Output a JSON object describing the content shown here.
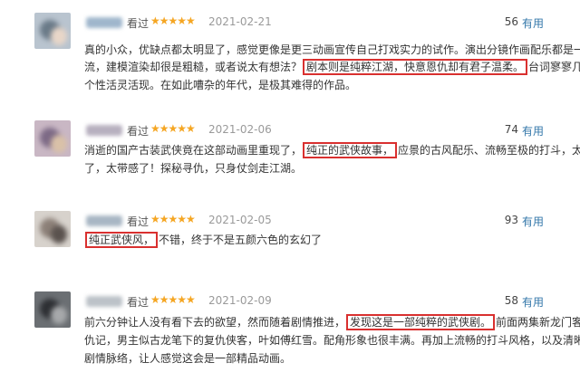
{
  "labels": {
    "watched": "看过",
    "stars": "★★★★★",
    "useful": "有用"
  },
  "colors": {
    "star": "#f5a623",
    "highlight_box": "#d9302f",
    "link": "#3377aa",
    "date": "#9a9a9a"
  },
  "reviews": [
    {
      "date": "2021-02-21",
      "useful_count": "56",
      "lines": [
        {
          "pre": "真的小众，优缺点都太明显了，感觉更像是更三动画宣传自己打戏实力的试作。演出分镜作画配乐都是一"
        },
        {
          "pre": "流，建模渲染却很是粗糙，或者说太有想法？",
          "hl": "剧本则是纯粹江湖，快意恩仇却有君子温柔。",
          "post": "台词寥寥几句，"
        },
        {
          "pre": "个性活灵活现。在如此嘈杂的年代，是极其难得的作品。"
        }
      ]
    },
    {
      "date": "2021-02-06",
      "useful_count": "74",
      "lines": [
        {
          "pre": "消逝的国产古装武侠竟在这部动画里重现了，",
          "hl": "纯正的武侠故事，",
          "post": "应景的古风配乐、流畅至极的打斗，太绝"
        },
        {
          "pre": "了，太带感了！探秘寻仇，只身仗剑走江湖。"
        }
      ]
    },
    {
      "date": "2021-02-05",
      "useful_count": "93",
      "lines": [
        {
          "pre": "",
          "hl": "纯正武侠风，",
          "post": "不错，终于不是五颜六色的玄幻了"
        }
      ]
    },
    {
      "date": "2021-02-09",
      "useful_count": "58",
      "lines": [
        {
          "pre": "前六分钟让人没有看下去的欲望，然而随着剧情推进，",
          "hl": "发现这是一部纯粹的武侠剧。",
          "post": "前面两集新龙门客栈复"
        },
        {
          "pre": "仇记，男主似古龙笔下的复仇侠客，叶如傅红雪。配角形象也很丰满。再加上流畅的打斗风格，以及清晰的"
        },
        {
          "pre": "剧情脉络，让人感觉这会是一部精品动画。"
        }
      ]
    }
  ]
}
